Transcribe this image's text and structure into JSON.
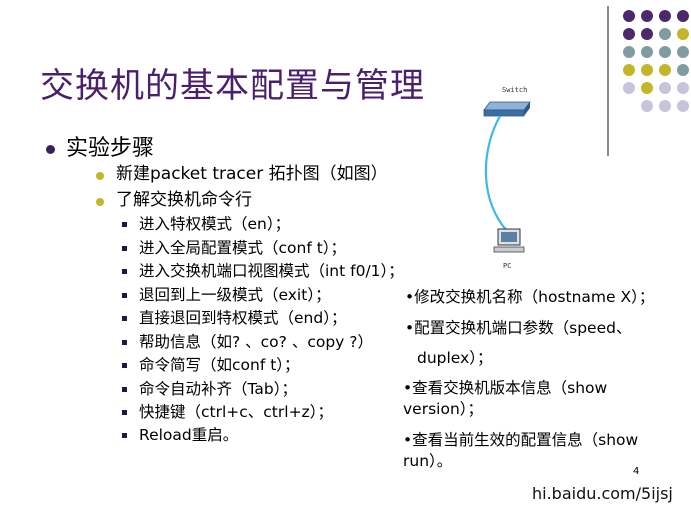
{
  "title": "交换机的基本配置与管理",
  "section": {
    "heading": "实验步骤",
    "items": [
      {
        "label": "新建packet tracer 拓扑图（如图）"
      },
      {
        "label": "了解交换机命令行"
      }
    ],
    "steps": [
      "进入特权模式（en）；",
      "进入全局配置模式（conf t）；",
      "进入交换机端口视图模式（int f0/1）；",
      "退回到上一级模式（exit）；",
      "直接退回到特权模式（end）；",
      "帮助信息（如? 、co? 、copy ?）",
      "命令简写（如conf t）；",
      "命令自动补齐（Tab）；",
      "快捷键（ctrl+c、ctrl+z）；",
      "Reload重启。"
    ]
  },
  "right_column": [
    "•修改交换机名称（hostname X）；",
    "•配置交换机端口参数（speed、",
    "duplex）；",
    "•查看交换机版本信息（show",
    "version）；",
    "•查看当前生效的配置信息（show",
    "run）。"
  ],
  "diagram": {
    "switch_label": "Switch",
    "pc_label": "PC"
  },
  "page_number": "4",
  "watermark": "hi.baidu.com/5ijsj",
  "colors": {
    "title": "#4a1f6e",
    "dot_purple": "#4b2a6b",
    "dot_teal": "#7f9ca0",
    "dot_yellow": "#c4b52a",
    "dot_lavender": "#c9c3d9",
    "cable": "#3fb7e8"
  }
}
